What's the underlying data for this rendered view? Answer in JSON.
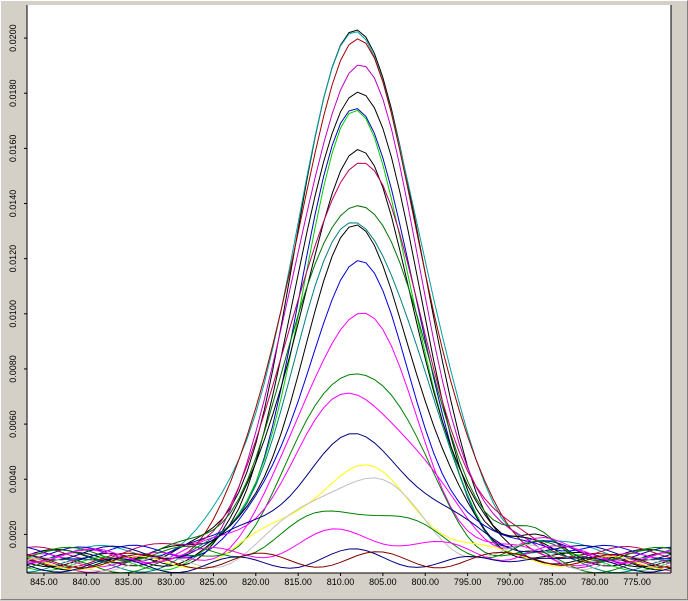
{
  "chart_data": {
    "type": "line",
    "title": "",
    "xlabel": "",
    "ylabel": "",
    "x_reversed": true,
    "xlim": [
      847,
      771
    ],
    "ylim": [
      0.0006,
      0.0212
    ],
    "grid": false,
    "x_ticks": [
      "845.00",
      "840.00",
      "835.00",
      "830.00",
      "825.00",
      "820.00",
      "815.00",
      "810.00",
      "805.00",
      "800.00",
      "795.00",
      "790.00",
      "785.00",
      "780.00",
      "775.00"
    ],
    "y_ticks": [
      "0.0020",
      "0.0040",
      "0.0060",
      "0.0080",
      "0.0100",
      "0.0120",
      "0.0140",
      "0.0160",
      "0.0180",
      "0.0200"
    ],
    "peak_x": 808,
    "peak_heights": [
      0.0205,
      0.0201,
      0.0197,
      0.019,
      0.0183,
      0.0176,
      0.0172,
      0.0157,
      0.0155,
      0.0142,
      0.0134,
      0.013,
      0.0117,
      0.0101,
      0.0081,
      0.0071,
      0.0054,
      0.0043,
      0.0041,
      0.003,
      0.002,
      0.0012,
      0.0011
    ],
    "colors": [
      "#000000",
      "#00a0a0",
      "#a00000",
      "#c000c0",
      "#000000",
      "#0000c0",
      "#00d000",
      "#000000",
      "#c00060",
      "#007000",
      "#008080",
      "#000000",
      "#0000e0",
      "#ff00ff",
      "#008000",
      "#ff00ff",
      "#000080",
      "#ffff00",
      "#c0c0c0",
      "#008000",
      "#ff00ff",
      "#000080",
      "#800000"
    ]
  }
}
